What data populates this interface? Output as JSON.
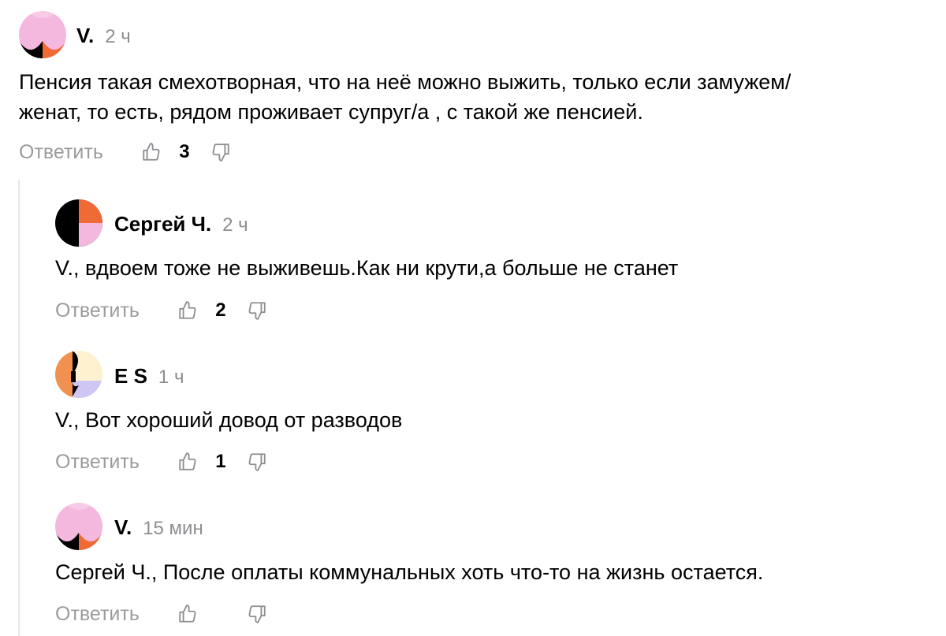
{
  "colors": {
    "pink": "#F4B8DF",
    "orange": "#F06A36",
    "black": "#000000",
    "peach": "#F0914F",
    "cream": "#FDF1CF",
    "lavender": "#CFC6F4",
    "muted_text": "#9B9B9B",
    "thread_line": "#E6E6E6"
  },
  "comments": [
    {
      "author": "V.",
      "time": "2 ч",
      "avatar_icon": "avatar-pink-orange-icon",
      "text_lines": [
        "Пенсия такая смехотворная, что на неё можно выжить, только если замужем/",
        "женат, то есть, рядом проживает супруг/а , с такой же пенсией."
      ],
      "reply_label": "Ответить",
      "likes": "3"
    },
    {
      "author": "Сергей Ч.",
      "time": "2 ч",
      "avatar_icon": "avatar-black-orange-pink-icon",
      "text_lines": [
        "V., вдвоем тоже не выживешь.Как ни крути,а больше не станет"
      ],
      "reply_label": "Ответить",
      "likes": "2"
    },
    {
      "author": "E S",
      "time": "1 ч",
      "avatar_icon": "avatar-peach-cream-lavender-icon",
      "text_lines": [
        "V., Вот хороший довод от разводов"
      ],
      "reply_label": "Ответить",
      "likes": "1"
    },
    {
      "author": "V.",
      "time": "15 мин",
      "avatar_icon": "avatar-pink-orange-icon",
      "text_lines": [
        "Сергей Ч., После оплаты коммунальных хоть что-то на жизнь остается."
      ],
      "reply_label": "Ответить",
      "likes": ""
    }
  ]
}
